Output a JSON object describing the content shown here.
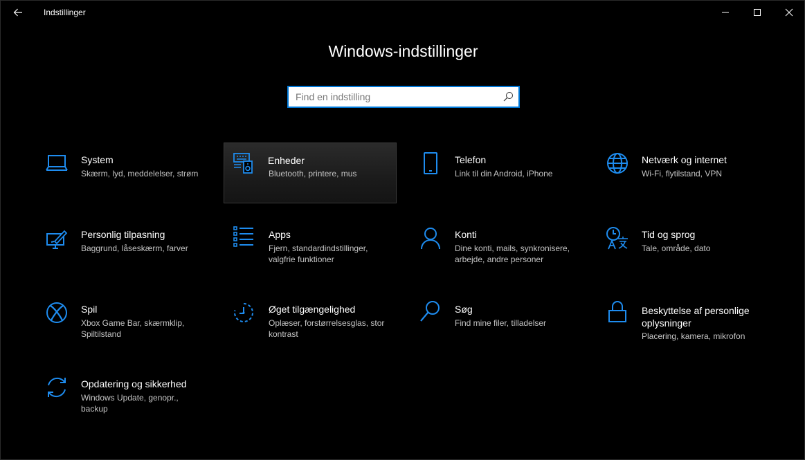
{
  "window": {
    "title": "Indstillinger"
  },
  "header": {
    "page_title": "Windows-indstillinger"
  },
  "search": {
    "placeholder": "Find en indstilling",
    "value": ""
  },
  "colors": {
    "accent": "#0078d7",
    "icon": "#1e8cef",
    "background": "#000000"
  },
  "tiles": [
    {
      "icon": "laptop-icon",
      "name": "System",
      "desc": "Skærm, lyd, meddelelser, strøm"
    },
    {
      "icon": "devices-icon",
      "name": "Enheder",
      "desc": "Bluetooth, printere, mus"
    },
    {
      "icon": "phone-icon",
      "name": "Telefon",
      "desc": "Link til din Android, iPhone"
    },
    {
      "icon": "globe-icon",
      "name": "Netværk og internet",
      "desc": "Wi-Fi, flytilstand, VPN"
    },
    {
      "icon": "personalization-icon",
      "name": "Personlig tilpasning",
      "desc": "Baggrund, låseskærm, farver"
    },
    {
      "icon": "apps-list-icon",
      "name": "Apps",
      "desc": "Fjern, standardindstillinger, valgfrie funktioner"
    },
    {
      "icon": "person-icon",
      "name": "Konti",
      "desc": "Dine konti, mails, synkronisere, arbejde, andre personer"
    },
    {
      "icon": "time-language-icon",
      "name": "Tid og sprog",
      "desc": "Tale, område, dato"
    },
    {
      "icon": "xbox-icon",
      "name": "Spil",
      "desc": "Xbox Game Bar, skærmklip, Spiltilstand"
    },
    {
      "icon": "ease-of-access-icon",
      "name": "Øget tilgængelighed",
      "desc": "Oplæser, forstørrelsesglas, stor kontrast"
    },
    {
      "icon": "search-icon",
      "name": "Søg",
      "desc": "Find mine filer, tilladelser"
    },
    {
      "icon": "lock-icon",
      "name": "Beskyttelse af personlige oplysninger",
      "desc": "Placering, kamera, mikrofon"
    },
    {
      "icon": "update-sync-icon",
      "name": "Opdatering og sikkerhed",
      "desc": "Windows Update, genopr., backup"
    }
  ]
}
